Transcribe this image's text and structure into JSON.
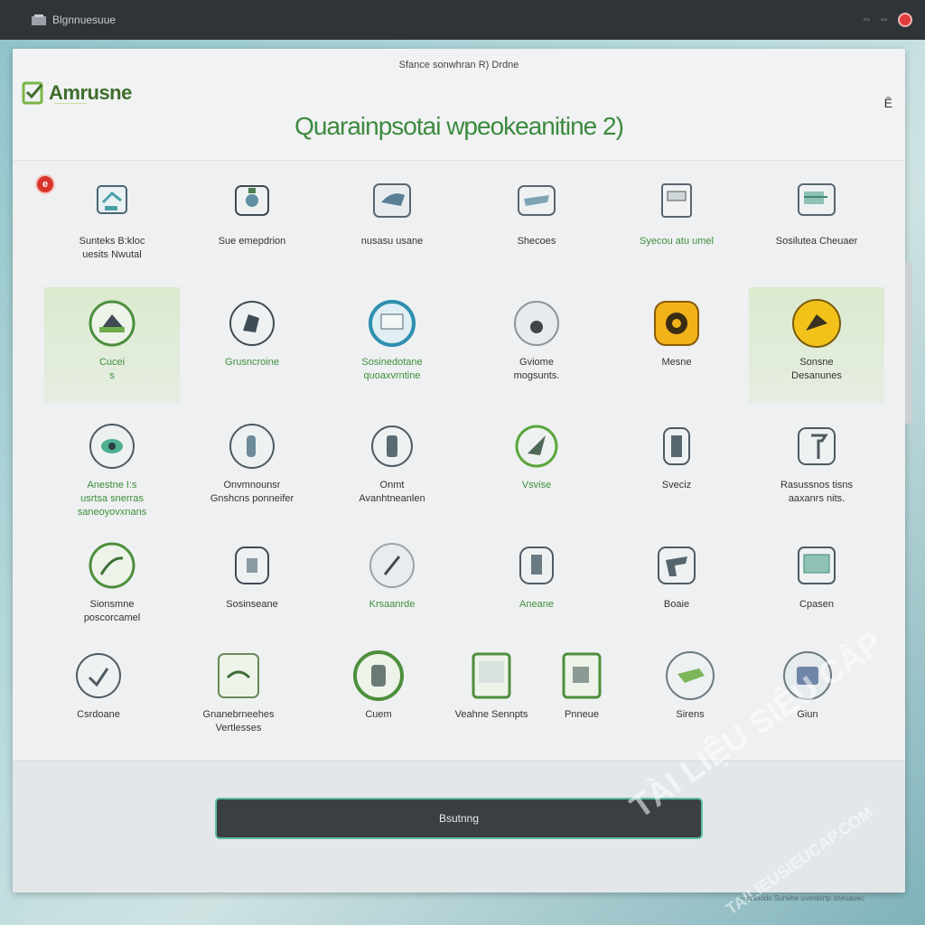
{
  "topbar": {
    "title": "Blgnnuesuue",
    "tiny": "▫▫"
  },
  "header": {
    "subtitle": "Sfance sonwhran R) Drdne",
    "brand_name": "Amrusne",
    "brand_tag": "——————",
    "menu_glyph": "Ē",
    "title": "Quarainpsotai wpeokeanitine 2)"
  },
  "badge": "e",
  "items": [
    {
      "label": "Sunteks B:kloc\nuesits Nwutal",
      "icon": "device",
      "green": false,
      "hl": false
    },
    {
      "label": "Sue emepdrion",
      "icon": "scanner",
      "green": false,
      "hl": false
    },
    {
      "label": "nusasu usane",
      "icon": "hand",
      "green": false,
      "hl": false
    },
    {
      "label": "Shecoes",
      "icon": "tray",
      "green": false,
      "hl": false
    },
    {
      "label": "Syecou atu umel",
      "icon": "box",
      "green": true,
      "hl": false
    },
    {
      "label": "Sosilutea Cheuaer",
      "icon": "printer",
      "green": false,
      "hl": false
    },
    {
      "label": "Cucei\ns",
      "icon": "camera",
      "green": true,
      "hl": true
    },
    {
      "label": "Grusncroine",
      "icon": "pen",
      "green": true,
      "hl": false
    },
    {
      "label": "Sosinedotane\nquoaxvrntine",
      "icon": "label",
      "green": true,
      "hl": false
    },
    {
      "label": "Gviome\nmogsunts.",
      "icon": "drop",
      "green": false,
      "hl": false
    },
    {
      "label": "Mesne",
      "icon": "yellowcam",
      "green": false,
      "hl": false
    },
    {
      "label": "Sonsne\nDesanunes",
      "icon": "yellowhand",
      "green": false,
      "hl": true
    },
    {
      "label": "Anestne I:s\nusrtsa snerras\nsaneoyovxnans",
      "icon": "eye",
      "green": true,
      "hl": false
    },
    {
      "label": "Onvmnounsr\nGnshcns ponneifer",
      "icon": "scanhand",
      "green": false,
      "hl": false
    },
    {
      "label": "Onmt\nAvanhtneanlen",
      "icon": "bottle",
      "green": false,
      "hl": false
    },
    {
      "label": "Vsvise",
      "icon": "leaf",
      "green": true,
      "hl": false
    },
    {
      "label": "Sveciz",
      "icon": "cylinder",
      "green": false,
      "hl": false
    },
    {
      "label": "Rasussnos tisns\naaxanrs nits.",
      "icon": "tap",
      "green": false,
      "hl": false
    },
    {
      "label": "Sionsmne\nposcorcamel",
      "icon": "wave",
      "green": false,
      "hl": false
    },
    {
      "label": "Sosinseane",
      "icon": "docscan",
      "green": false,
      "hl": false
    },
    {
      "label": "Krsaanrde",
      "icon": "slash",
      "green": true,
      "hl": false
    },
    {
      "label": "Aneane",
      "icon": "phone",
      "green": true,
      "hl": false
    },
    {
      "label": "Boaie",
      "icon": "gun",
      "green": false,
      "hl": false
    },
    {
      "label": "Cpasen",
      "icon": "screen",
      "green": false,
      "hl": false
    },
    {
      "label": "Csrdoane",
      "icon": "check",
      "green": false,
      "hl": false
    },
    {
      "label": "Gnanebrneehes\nVertlesses",
      "icon": "wifi",
      "green": false,
      "hl": false
    },
    {
      "label": "Cuem",
      "icon": "glove",
      "green": false,
      "hl": false
    },
    {
      "label": "Veahne Sennpts",
      "icon": "kiosk",
      "green": false,
      "hl": false
    },
    {
      "label": "Pnneue",
      "icon": "tablet",
      "green": false,
      "hl": false
    },
    {
      "label": "Sirens",
      "icon": "shoe",
      "green": false,
      "hl": false
    },
    {
      "label": "Giun",
      "icon": "bluebox",
      "green": false,
      "hl": false
    }
  ],
  "footer": {
    "button_label": "Bsutnng"
  },
  "watermark": {
    "line1": "TÀI LIỆU SIÊU CẤP",
    "line2": "TAILIEUSIEUCAP.COM"
  },
  "bottom_note": "– cnloodo Sunvhe uvenbrrtp sheuauec"
}
